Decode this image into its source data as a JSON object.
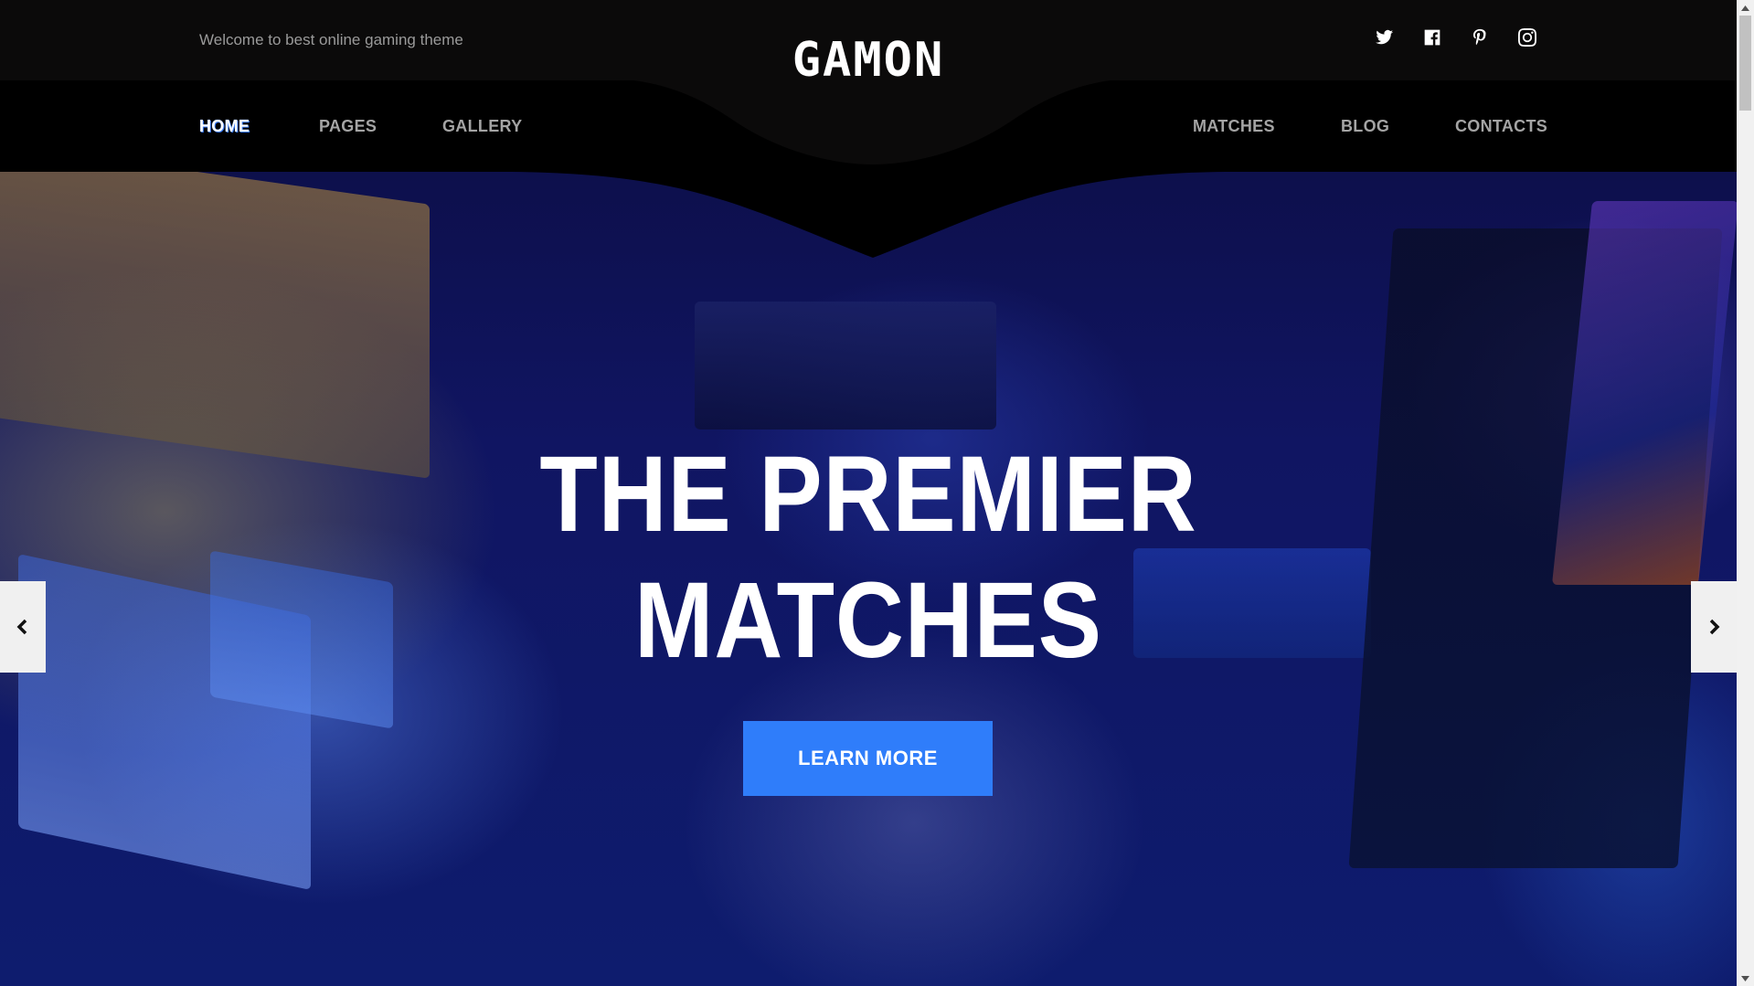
{
  "header": {
    "tagline": "Welcome to best online gaming theme",
    "logo_text": "GAMON",
    "social": [
      {
        "name": "twitter-icon"
      },
      {
        "name": "facebook-icon"
      },
      {
        "name": "pinterest-icon"
      },
      {
        "name": "instagram-icon"
      }
    ]
  },
  "nav": {
    "left": [
      {
        "label": "HOME",
        "active": true
      },
      {
        "label": "PAGES",
        "active": false
      },
      {
        "label": "GALLERY",
        "active": false
      }
    ],
    "right": [
      {
        "label": "MATCHES",
        "active": false
      },
      {
        "label": "BLOG",
        "active": false
      },
      {
        "label": "CONTACTS",
        "active": false
      }
    ]
  },
  "hero": {
    "title_line1": "THE PREMIER",
    "title_line2": "MATCHES",
    "cta_label": "LEARN MORE"
  },
  "slider": {
    "prev_icon": "chevron-left-icon",
    "next_icon": "chevron-right-icon"
  },
  "colors": {
    "accent": "#2f7dfa",
    "topbar_bg": "#0b0a0a",
    "nav_bg": "#000000",
    "nav_text": "#a4a4a4",
    "tagline_text": "#9a9a9a"
  }
}
